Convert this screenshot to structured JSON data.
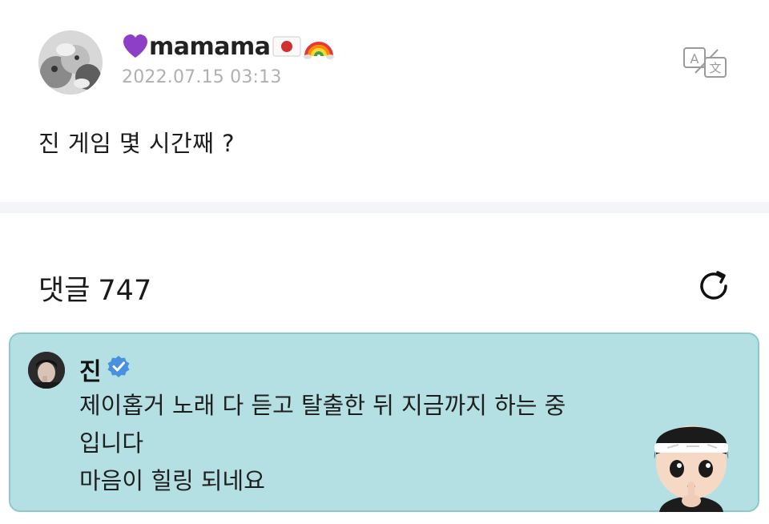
{
  "post": {
    "author_name": "mamama",
    "author_emoji_prefix": "purple-heart",
    "author_emoji_suffix": [
      "japan-flag",
      "rainbow"
    ],
    "timestamp": "2022.07.15 03:13",
    "content": "진 게임 몇 시간째 ?",
    "translate_icon": "translate-icon"
  },
  "comments": {
    "label": "댓글",
    "count": "747",
    "refresh_icon": "refresh-icon"
  },
  "highlighted_comment": {
    "author": "진",
    "verified": true,
    "lines": [
      "제이홉거 노래 다 듣고 탈출한 뒤 지금까지 하는 중",
      "입니다",
      "마음이 힐링 되네요"
    ],
    "background_color": "#b4e0e3",
    "verified_color": "#4a90e2"
  }
}
